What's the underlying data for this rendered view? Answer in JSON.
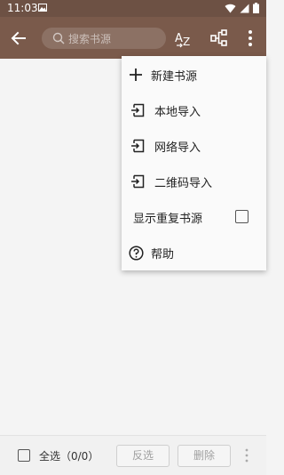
{
  "status_bar": {
    "time": "11:03",
    "icons": [
      "image-icon",
      "wifi-icon",
      "signal-icon",
      "battery-icon"
    ]
  },
  "app_bar": {
    "search_placeholder": "搜索书源",
    "icons": [
      "arrow-back-icon",
      "search-icon",
      "sort-az-icon",
      "group-icon",
      "more-vert-icon"
    ]
  },
  "menu": {
    "new_source": "新建书源",
    "import_local": "本地导入",
    "import_online": "网络导入",
    "import_qrcode": "二维码导入",
    "show_duplicates": "显示重复书源",
    "help": "帮助"
  },
  "bottom_bar": {
    "select_all": "全选（0/0）",
    "invert": "反选",
    "delete": "删除"
  },
  "colors": {
    "app_bar": "#7a5a4b",
    "status_bar": "#6d5144",
    "background": "#f4f4f4"
  }
}
